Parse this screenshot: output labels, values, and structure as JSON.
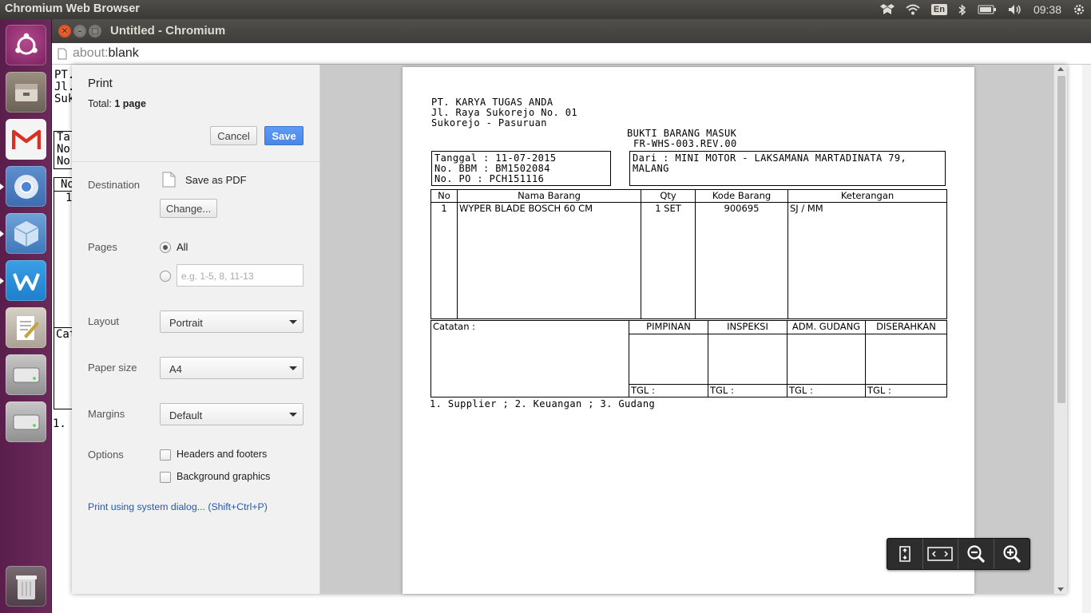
{
  "topbar": {
    "app_title": "Chromium Web Browser",
    "keyboard_layout": "En",
    "clock": "09:38"
  },
  "window": {
    "title": "Untitled - Chromium",
    "url_scheme": "about:",
    "url_rest": "blank"
  },
  "background_page": {
    "lines": [
      "PT.",
      "Jl.",
      "Suk"
    ],
    "box_lines": [
      "Ta",
      "No",
      "No"
    ],
    "table_header": "No",
    "table_row": "1",
    "catatan": "Cat",
    "footer": "1. S"
  },
  "print": {
    "heading": "Print",
    "total_label": "Total:",
    "total_value": "1 page",
    "cancel_label": "Cancel",
    "save_label": "Save",
    "destination_label": "Destination",
    "destination_value": "Save as PDF",
    "change_label": "Change...",
    "pages_label": "Pages",
    "pages_all": "All",
    "pages_placeholder": "e.g. 1-5, 8, 11-13",
    "layout_label": "Layout",
    "layout_value": "Portrait",
    "paper_label": "Paper size",
    "paper_value": "A4",
    "margins_label": "Margins",
    "margins_value": "Default",
    "options_label": "Options",
    "opt_headers": "Headers and footers",
    "opt_background": "Background graphics",
    "system_dialog": "Print using system dialog... (Shift+Ctrl+P)"
  },
  "document": {
    "company": "PT. KARYA TUGAS ANDA",
    "address1": "Jl. Raya Sukorejo No. 01",
    "address2": "Sukorejo - Pasuruan",
    "doc_title": "BUKTI BARANG MASUK",
    "doc_code": "FR-WHS-003.REV.00",
    "tanggal": "Tanggal : 11-07-2015",
    "no_bbm": "No. BBM : BM1502084",
    "no_po": "No. PO : PCH151116",
    "dari": "Dari : MINI MOTOR - LAKSAMANA MARTADINATA 79,",
    "dari2": "MALANG",
    "columns": [
      "No",
      "Nama Barang",
      "Qty",
      "Kode Barang",
      "Keterangan"
    ],
    "rows": [
      {
        "no": "1",
        "nama": "WYPER BLADE BOSCH 60 CM",
        "qty": "1 SET",
        "kode": "900695",
        "ket": "SJ / MM"
      }
    ],
    "catatan_label": "Catatan :",
    "signers": [
      "PIMPINAN",
      "INSPEKSI",
      "ADM. GUDANG",
      "DISERAHKAN"
    ],
    "tgl_label": "TGL :",
    "copies": "1. Supplier ; 2. Keuangan ; 3. Gudang"
  }
}
